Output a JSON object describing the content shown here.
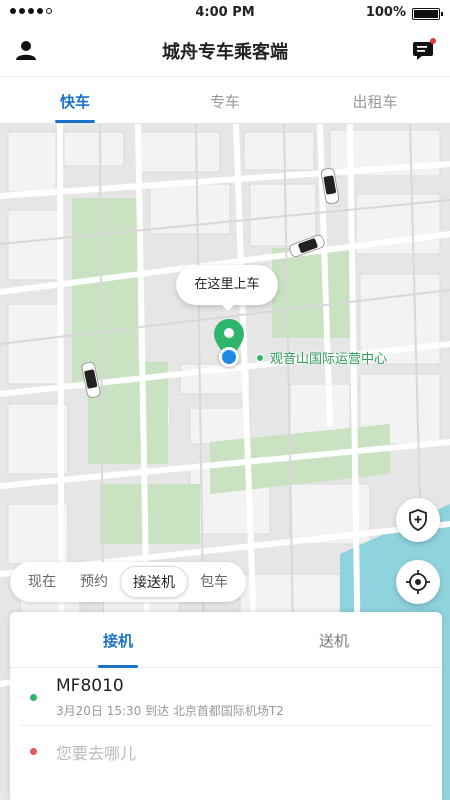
{
  "status_bar": {
    "time": "4:00 PM",
    "battery": "100%",
    "battery_level": 1.0
  },
  "header": {
    "title": "城舟专车乘客端",
    "left_icon": "user-icon",
    "right_icon": "message-icon",
    "message_badge_color": "#e53935"
  },
  "service_tabs": [
    {
      "label": "快车",
      "active": true
    },
    {
      "label": "专车",
      "active": false
    },
    {
      "label": "出租车",
      "active": false
    }
  ],
  "map": {
    "pickup_bubble": "在这里上车",
    "poi_label": "观音山国际运营中心",
    "safety_icon": "shield-plus-icon",
    "locate_icon": "crosshair-icon"
  },
  "ride_modes": [
    {
      "label": "现在",
      "active": false
    },
    {
      "label": "预约",
      "active": false
    },
    {
      "label": "接送机",
      "active": true
    },
    {
      "label": "包车",
      "active": false
    }
  ],
  "airport_card": {
    "tabs": [
      {
        "label": "接机",
        "active": true
      },
      {
        "label": "送机",
        "active": false
      }
    ],
    "flight": {
      "number": "MF8010",
      "info": "3月20日 15:30 到达 北京首都国际机场T2"
    },
    "destination_placeholder": "您要去哪儿"
  },
  "colors": {
    "accent": "#1a73c9",
    "green": "#2fb56d",
    "red": "#e85a5a",
    "water": "#8fd3df",
    "park": "#c9e2c1"
  }
}
